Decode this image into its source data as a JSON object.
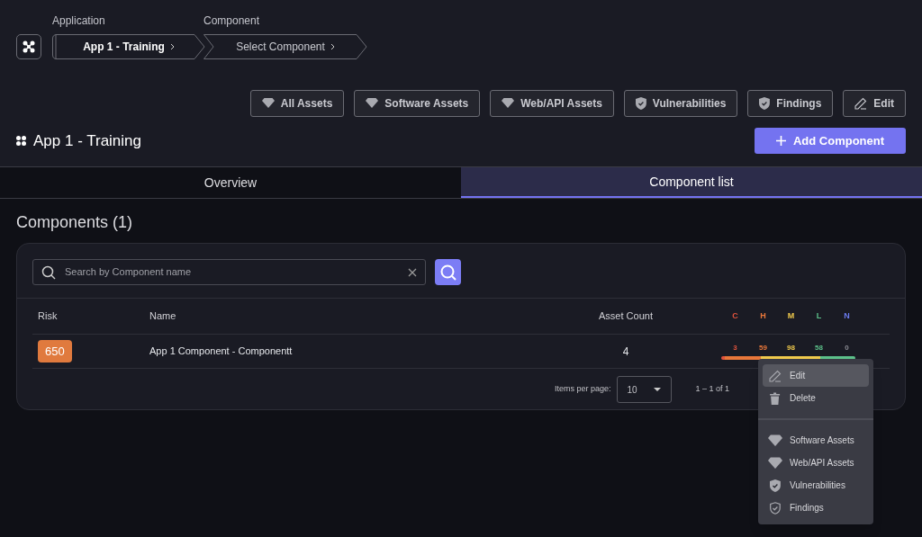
{
  "breadcrumb": [
    {
      "caption": "Application",
      "label": "App 1 - Training",
      "current": true
    },
    {
      "caption": "Component",
      "label": "Select Component",
      "current": false
    }
  ],
  "toolbar": [
    {
      "label": "All Assets",
      "kind": "diamond"
    },
    {
      "label": "Software Assets",
      "kind": "diamond"
    },
    {
      "label": "Web/API Assets",
      "kind": "diamond"
    },
    {
      "label": "Vulnerabilities",
      "kind": "shield"
    },
    {
      "label": "Findings",
      "kind": "shield"
    },
    {
      "label": "Edit",
      "kind": "pencil"
    }
  ],
  "title": "App 1 - Training",
  "add_button": "Add Component",
  "tabs": [
    {
      "label": "Overview",
      "selected": false
    },
    {
      "label": "Component list",
      "selected": true
    }
  ],
  "section_title": "Components (1)",
  "search": {
    "placeholder": "Search by Component name"
  },
  "table": {
    "columns": [
      "Risk",
      "Name",
      "Asset Count"
    ],
    "severity_columns": [
      {
        "label": "C",
        "color": "#e0533d"
      },
      {
        "label": "H",
        "color": "#e8773a"
      },
      {
        "label": "M",
        "color": "#efc94c"
      },
      {
        "label": "L",
        "color": "#5cc08a"
      },
      {
        "label": "N",
        "color": "#6b7cf0"
      }
    ],
    "rows": [
      {
        "risk": "650",
        "name": "App 1 Component - Componentt",
        "asset_count": "4",
        "severity_counts": [
          "3",
          "59",
          "98",
          "58",
          "0"
        ]
      }
    ]
  },
  "pagination": {
    "label": "Items per page:",
    "page_size": "10",
    "range": "1 – 1 of 1"
  },
  "context_menu": [
    {
      "label": "Edit",
      "kind": "pencil",
      "selected": true,
      "divider_before": false
    },
    {
      "label": "Delete",
      "kind": "trash",
      "selected": false,
      "divider_before": false
    },
    {
      "label": "Software Assets",
      "kind": "diamond",
      "selected": false,
      "divider_before": true
    },
    {
      "label": "Web/API Assets",
      "kind": "diamond",
      "selected": false,
      "divider_before": false
    },
    {
      "label": "Vulnerabilities",
      "kind": "shield",
      "selected": false,
      "divider_before": false
    },
    {
      "label": "Findings",
      "kind": "shield-outline",
      "selected": false,
      "divider_before": false
    }
  ]
}
